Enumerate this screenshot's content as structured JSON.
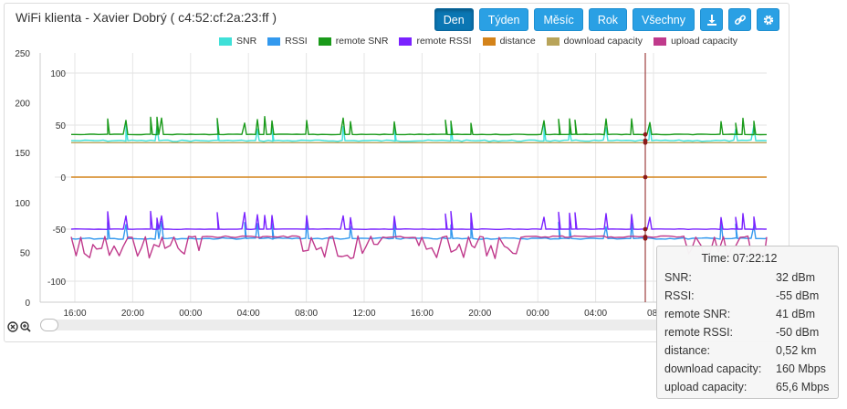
{
  "title": "WiFi klienta - Xavier Dobrý ( c4:52:cf:2a:23:ff )",
  "toolbar": {
    "day": "Den",
    "week": "Týden",
    "month": "Měsíc",
    "year": "Rok",
    "all": "Všechny",
    "download_icon": "download-icon",
    "link_icon": "link-icon",
    "settings_icon": "gear-icon",
    "active": "Den"
  },
  "chart_data": {
    "type": "line",
    "legend_position": "top",
    "series": [
      {
        "name": "SNR",
        "color": "#3fe0d8",
        "axis": "inner",
        "baseline": 35,
        "spikes": [
          35,
          35,
          35,
          35,
          35
        ]
      },
      {
        "name": "RSSI",
        "color": "#3399ee",
        "axis": "inner",
        "baseline": -59,
        "spikes": [
          -59,
          -59,
          -59
        ]
      },
      {
        "name": "remote SNR",
        "color": "#1a9a1a",
        "axis": "inner",
        "baseline": 41,
        "spikes": [
          41,
          41,
          41
        ]
      },
      {
        "name": "remote RSSI",
        "color": "#7a22ff",
        "axis": "inner",
        "baseline": -50,
        "spikes": [
          -50,
          -50
        ]
      },
      {
        "name": "distance",
        "color": "#d4831a",
        "axis": "inner",
        "baseline": 0
      },
      {
        "name": "download capacity",
        "color": "#b8a45a",
        "axis": "outer",
        "baseline": 160
      },
      {
        "name": "upload capacity",
        "color": "#c03a8c",
        "axis": "outer",
        "baseline": 65.6
      }
    ],
    "outer_axis": {
      "ticks": [
        0,
        50,
        100,
        150,
        200,
        250
      ],
      "range": [
        0,
        250
      ]
    },
    "inner_axis": {
      "ticks": [
        -100,
        -50,
        0,
        50,
        100
      ],
      "range": [
        -125,
        125
      ]
    },
    "x_ticks": [
      "16:00",
      "20:00",
      "00:00",
      "04:00",
      "08:00",
      "12:00",
      "16:00",
      "20:00",
      "00:00",
      "04:00",
      "08:"
    ],
    "grid": true
  },
  "tooltip": {
    "time": "Time: 07:22:12",
    "rows": [
      {
        "label": "SNR:",
        "value": "32 dBm"
      },
      {
        "label": "RSSI:",
        "value": "-55 dBm"
      },
      {
        "label": "remote SNR:",
        "value": "41 dBm"
      },
      {
        "label": "remote RSSI:",
        "value": "-50 dBm"
      },
      {
        "label": "distance:",
        "value": "0,52 km"
      },
      {
        "label": "download capacity:",
        "value": "160 Mbps"
      },
      {
        "label": "upload capacity:",
        "value": "65,6 Mbps"
      }
    ]
  },
  "zoom": {
    "reset_icon": "zoom-reset-icon",
    "zoom_icon": "zoom-in-icon"
  }
}
